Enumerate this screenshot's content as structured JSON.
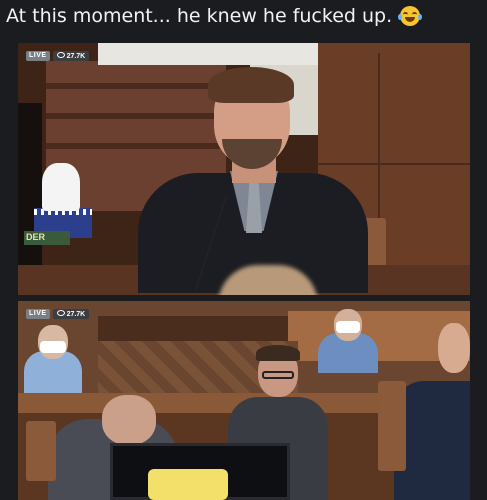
{
  "post": {
    "caption": "At this moment... he knew he fucked up.",
    "emoji": "face-with-tears-of-joy"
  },
  "stream_top": {
    "live_label": "LIVE",
    "viewer_count": "27.7K"
  },
  "stream_bottom": {
    "live_label": "LIVE",
    "viewer_count": "27.7K"
  },
  "scene": {
    "sign_text": "DER"
  },
  "colors": {
    "background": "#1b1c1f",
    "wood": "#5a3422",
    "live_badge": "#7a7f86"
  }
}
